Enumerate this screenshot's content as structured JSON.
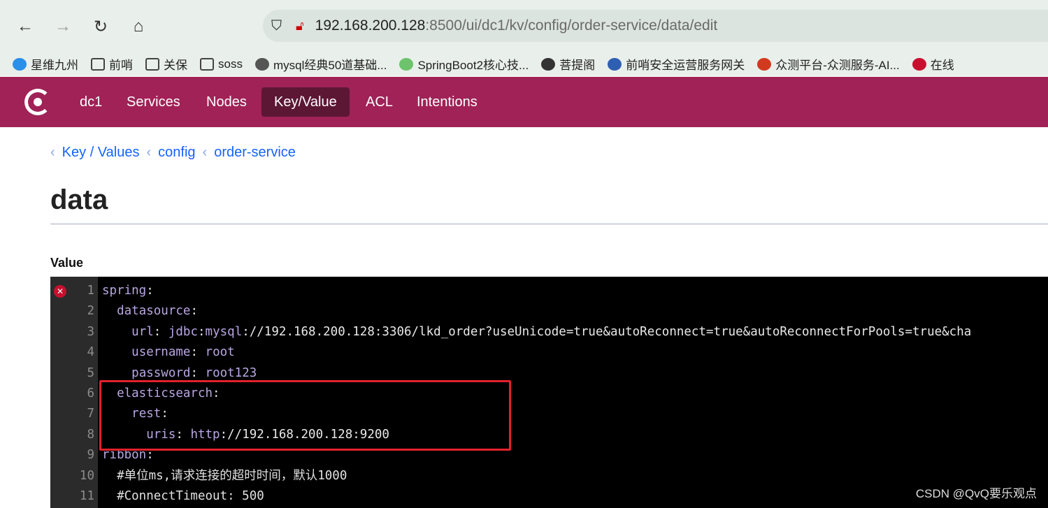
{
  "browser": {
    "url_host": "192.168.200.128",
    "url_rest": ":8500/ui/dc1/kv/config/order-service/data/edit",
    "bookmarks": [
      {
        "label": "星维九州",
        "icon": "globe-icon"
      },
      {
        "label": "前哨",
        "icon": "folder-icon"
      },
      {
        "label": "关保",
        "icon": "folder-icon"
      },
      {
        "label": "soss",
        "icon": "folder-icon"
      },
      {
        "label": "mysql经典50道基础...",
        "icon": "site-icon"
      },
      {
        "label": "SpringBoot2核心技...",
        "icon": "site-icon"
      },
      {
        "label": "菩提阁",
        "icon": "site-icon"
      },
      {
        "label": "前哨安全运营服务网关",
        "icon": "site-icon"
      },
      {
        "label": "众测平台-众测服务-AI...",
        "icon": "site-icon"
      },
      {
        "label": "在线",
        "icon": "site-icon"
      }
    ]
  },
  "nav": {
    "items": [
      "dc1",
      "Services",
      "Nodes",
      "Key/Value",
      "ACL",
      "Intentions"
    ],
    "active": "Key/Value",
    "color": "#a02257"
  },
  "breadcrumbs": [
    "Key / Values",
    "config",
    "order-service"
  ],
  "page": {
    "title": "data",
    "value_label": "Value"
  },
  "editor": {
    "lines": [
      [
        [
          "k",
          "spring"
        ],
        [
          "p",
          ":"
        ]
      ],
      [
        [
          "p",
          "  "
        ],
        [
          "k",
          "datasource"
        ],
        [
          "p",
          ":"
        ]
      ],
      [
        [
          "p",
          "    "
        ],
        [
          "k",
          "url"
        ],
        [
          "p",
          ": "
        ],
        [
          "k",
          "jdbc"
        ],
        [
          "p",
          ":"
        ],
        [
          "k",
          "mysql"
        ],
        [
          "s",
          "://192.168.200.128:3306/lkd_order?useUnicode=true&autoReconnect=true&autoReconnectForPools=true&cha"
        ]
      ],
      [
        [
          "p",
          "    "
        ],
        [
          "k",
          "username"
        ],
        [
          "p",
          ": "
        ],
        [
          "k",
          "root"
        ]
      ],
      [
        [
          "p",
          "    "
        ],
        [
          "k",
          "password"
        ],
        [
          "p",
          ": "
        ],
        [
          "k",
          "root123"
        ]
      ],
      [
        [
          "p",
          "  "
        ],
        [
          "k",
          "elasticsearch"
        ],
        [
          "p",
          ":"
        ]
      ],
      [
        [
          "p",
          "    "
        ],
        [
          "k",
          "rest"
        ],
        [
          "p",
          ":"
        ]
      ],
      [
        [
          "p",
          "      "
        ],
        [
          "k",
          "uris"
        ],
        [
          "p",
          ": "
        ],
        [
          "k",
          "http"
        ],
        [
          "s",
          "://192.168.200.128:9200"
        ]
      ],
      [
        [
          "k",
          "ribbon"
        ],
        [
          "p",
          ":"
        ]
      ],
      [
        [
          "c",
          "  #单位ms,请求连接的超时时间，默认1000"
        ]
      ],
      [
        [
          "c",
          "  #ConnectTimeout: 500"
        ]
      ]
    ]
  },
  "watermark": "CSDN @QvQ要乐观点"
}
